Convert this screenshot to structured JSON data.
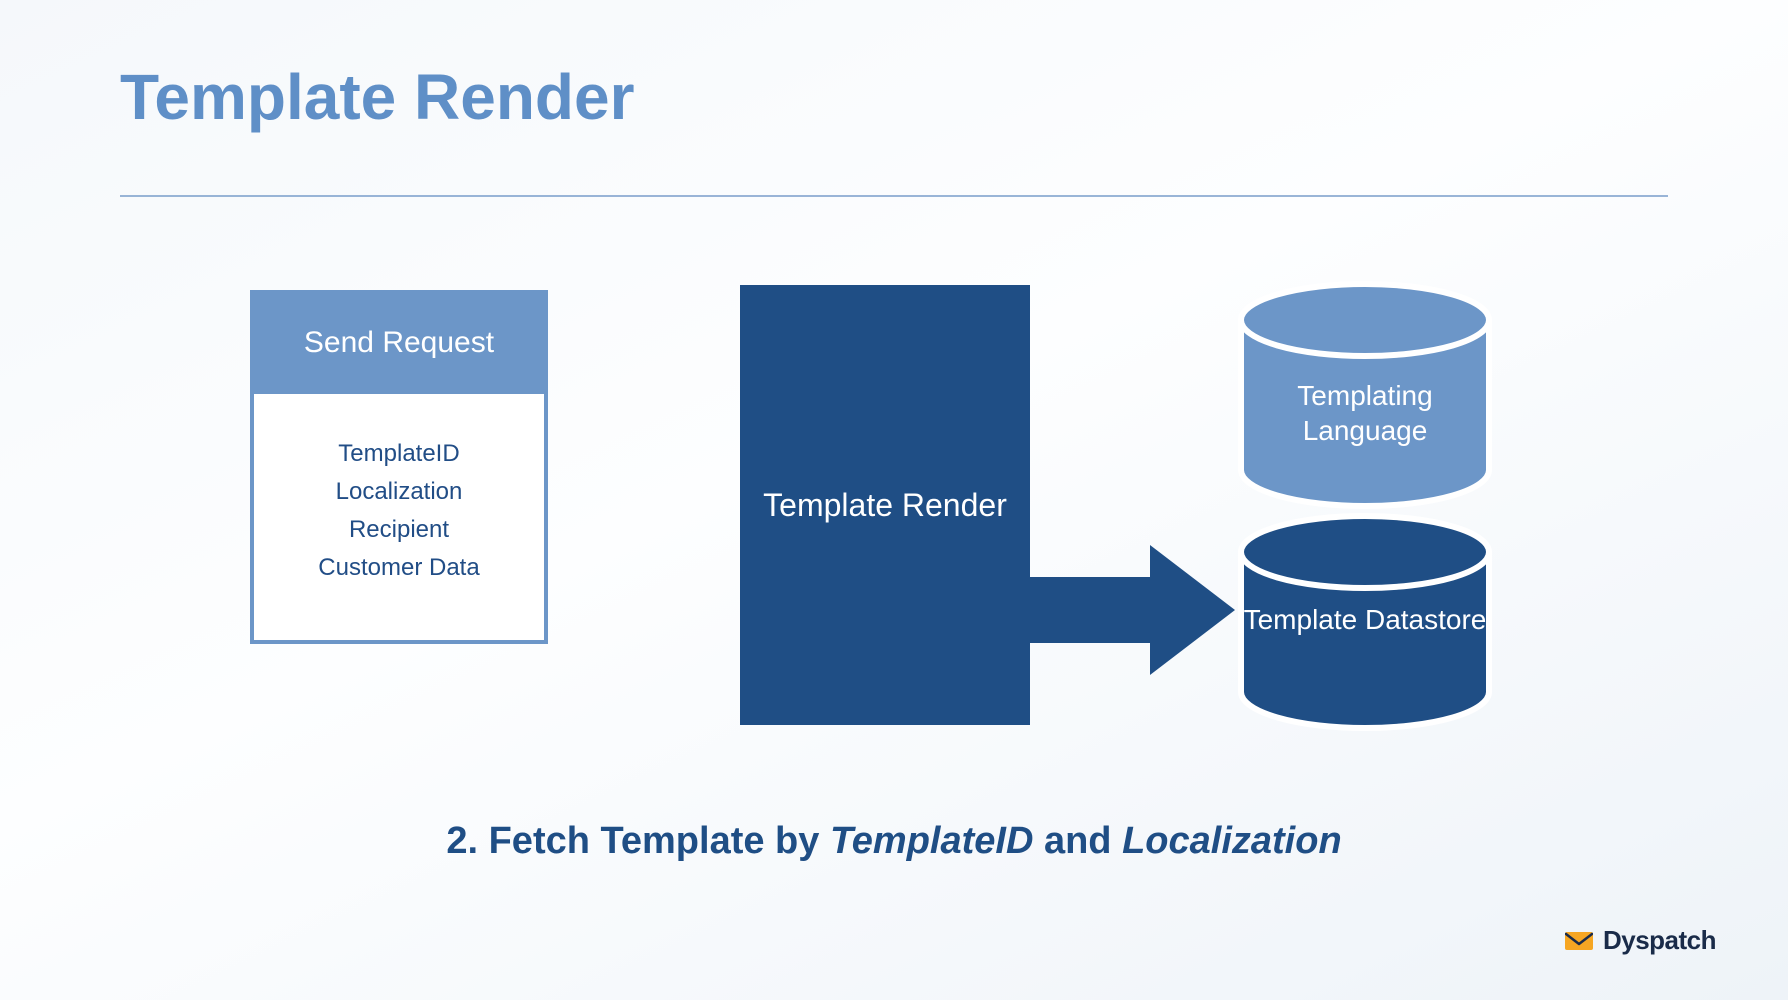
{
  "title": "Template Render",
  "send_request": {
    "header": "Send Request",
    "fields": [
      "TemplateID",
      "Localization",
      "Recipient",
      "Customer Data"
    ]
  },
  "render_block": {
    "label": "Template Render"
  },
  "cylinder_top": {
    "label": "Templating Language"
  },
  "cylinder_bottom": {
    "label": "Template Datastore"
  },
  "caption": {
    "prefix": "2. Fetch Template by ",
    "em1": "TemplateID",
    "mid": " and ",
    "em2": "Localization"
  },
  "logo": {
    "name": "Dyspatch"
  },
  "colors": {
    "title": "#5f8fc7",
    "light_blue": "#6c96c8",
    "dark_blue": "#1f4e85",
    "text": "#214d86"
  }
}
